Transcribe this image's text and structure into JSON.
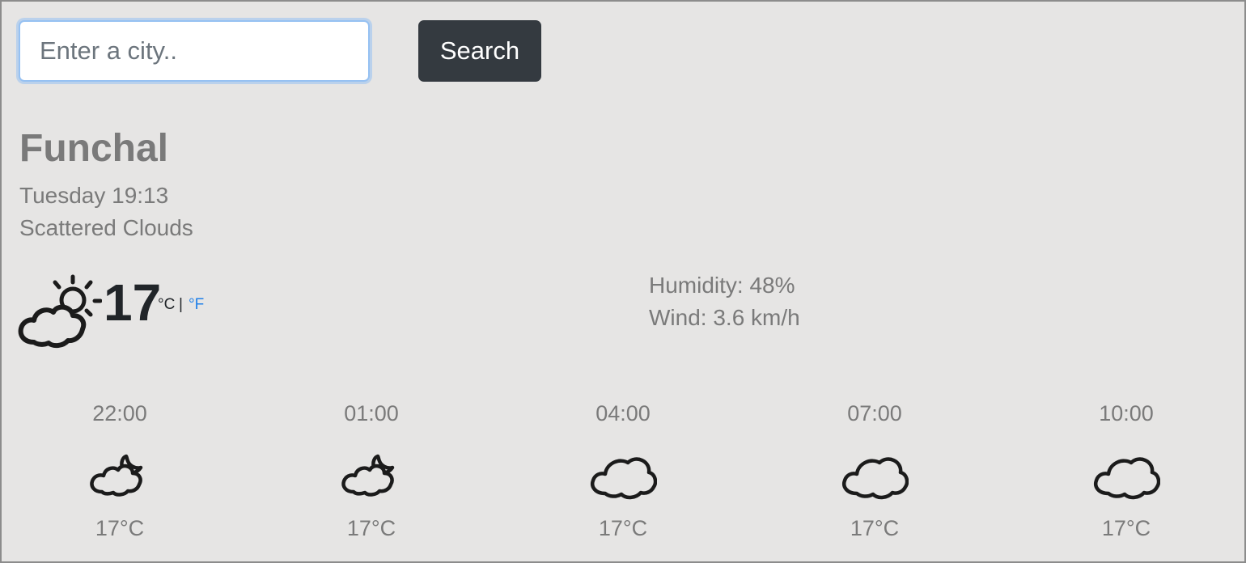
{
  "search": {
    "placeholder": "Enter a city..",
    "value": "",
    "button_label": "Search"
  },
  "current": {
    "city": "Funchal",
    "datetime": "Tuesday 19:13",
    "description": "Scattered Clouds",
    "icon": "partly-cloudy-day-icon",
    "temperature": "17",
    "unit_celsius": "°C",
    "unit_separator": "|",
    "unit_fahrenheit": "°F",
    "humidity": "Humidity: 48%",
    "wind": "Wind: 3.6 km/h"
  },
  "forecast": [
    {
      "time": "22:00",
      "icon": "partly-cloudy-night-icon",
      "temp": "17°C"
    },
    {
      "time": "01:00",
      "icon": "partly-cloudy-night-icon",
      "temp": "17°C"
    },
    {
      "time": "04:00",
      "icon": "cloud-icon",
      "temp": "17°C"
    },
    {
      "time": "07:00",
      "icon": "cloud-icon",
      "temp": "17°C"
    },
    {
      "time": "10:00",
      "icon": "cloud-icon",
      "temp": "17°C"
    }
  ],
  "colors": {
    "background": "#e6e5e4",
    "button": "#343a40",
    "muted_text": "#7a7a7a",
    "link": "#2080e8",
    "focus_ring": "#96c1f2"
  }
}
